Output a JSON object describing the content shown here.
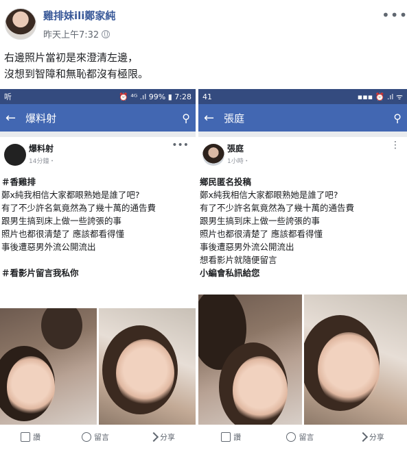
{
  "post": {
    "author": "雞排妹ili鄭家純",
    "time": "昨天上午7:32",
    "text_line1": "右邊照片當初是來澄清左邊，",
    "text_line2": "沒想到智障和無恥都沒有極限。"
  },
  "left_shot": {
    "status_left": "听",
    "status_right": "⏰ ⁴ᴳ .ıl 99% ▮ 7:28",
    "nav_title": "爆料射",
    "page_name": "爆料射",
    "time": "14分鐘・",
    "lines": [
      "＃香雞排",
      "鄭x純我相信大家都眼熟她是誰了吧?",
      "有了不少許名氣竟然為了幾十萬的通告費",
      "跟男生搞到床上做一些誇張的事",
      "照片也都很清楚了 應該都看得懂",
      "事後遭惡男外流公開流出",
      "",
      "＃看影片留言我私你"
    ],
    "like": "讚",
    "comment": "留言",
    "share": "分享"
  },
  "right_shot": {
    "status_left": "41",
    "status_right": "▪▪▪ ⏰ .ıl ᯤ",
    "nav_title": "張庭",
    "page_name": "張庭",
    "time": "1小時・",
    "lines": [
      "鄉民匿名投稿",
      "鄭x純我相信大家都眼熟她是誰了吧?",
      "有了不少許名氣竟然為了幾十萬的通告費",
      "跟男生搞到床上做一些誇張的事",
      "照片也都很清楚了 應該都看得懂",
      "事後遭惡男外流公開流出",
      "想看影片就隨便留言",
      "小編會私訊給您"
    ],
    "like": "讚",
    "comment": "留言",
    "share": "分享"
  }
}
